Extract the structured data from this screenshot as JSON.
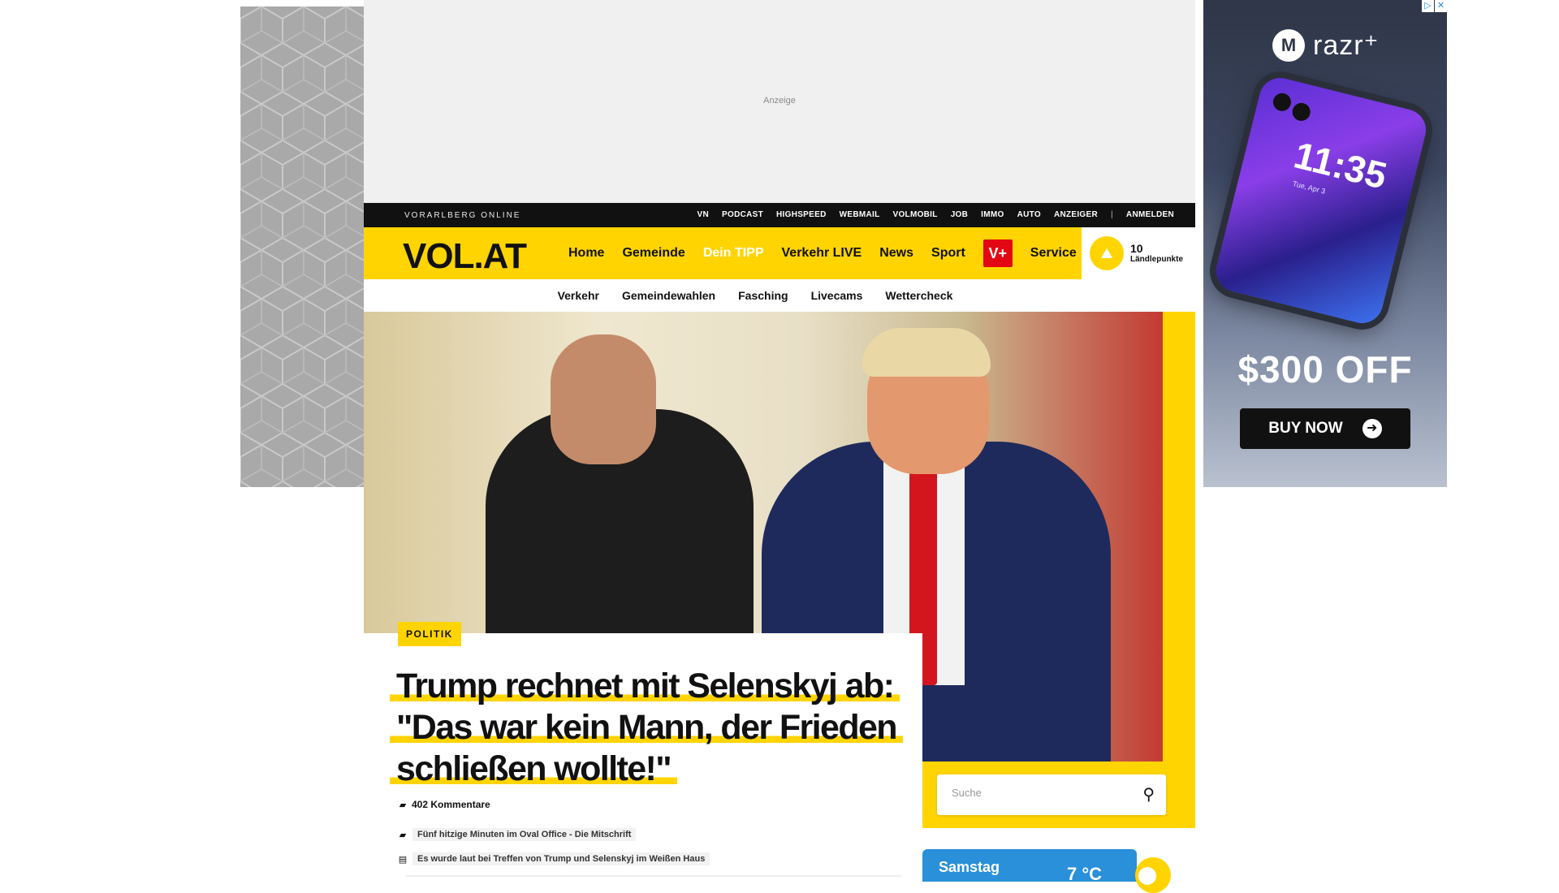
{
  "ad_top": {
    "label": "Anzeige"
  },
  "ad_right": {
    "adchoices": [
      "▷",
      "✕"
    ],
    "brand_logo": "M",
    "brand": "razr⁺",
    "phone_time": "11:35",
    "phone_date": "Tue, Apr 3",
    "offer": "$300 OFF",
    "cta": "BUY NOW",
    "cta_icon": "arrow-right-icon"
  },
  "topbar": {
    "brand": "VORARLBERG ONLINE",
    "links": [
      "VN",
      "PODCAST",
      "HIGHSPEED",
      "WEBMAIL",
      "VOLMOBIL",
      "JOB",
      "IMMO",
      "AUTO",
      "ANZEIGER"
    ],
    "separator": "|",
    "login": "ANMELDEN"
  },
  "nav": {
    "logo": "VOL.AT",
    "items": [
      "Home",
      "Gemeinde",
      "Dein TIPP",
      "Verkehr LIVE",
      "News",
      "Sport"
    ],
    "vplus": "V+",
    "service": "Service",
    "points_count": "10",
    "points_label": "Ländlepunkte"
  },
  "subnav": {
    "items": [
      "Verkehr",
      "Gemeindewahlen",
      "Fasching",
      "Livecams",
      "Wettercheck"
    ]
  },
  "article": {
    "tag": "POLITIK",
    "headline_lines": [
      "Trump rechnet mit Selenskyj ab:",
      "\"Das war kein Mann, der Frieden",
      "schließen wollte!\""
    ],
    "comments": "402 Kommentare",
    "related": [
      {
        "icon": "comment-icon",
        "text": "Fünf hitzige Minuten im Oval Office - Die Mitschrift"
      },
      {
        "icon": "article-icon",
        "text": "Es wurde laut bei Treffen von Trump und Selenskyj im Weißen Haus"
      }
    ]
  },
  "search": {
    "placeholder": "Suche"
  },
  "weather": {
    "day": "Samstag",
    "temp": "7 °C"
  },
  "colors": {
    "brand_yellow": "#ffd400",
    "topbar": "#111111",
    "vplus_red": "#e30613",
    "weather_blue": "#2a90d9"
  }
}
